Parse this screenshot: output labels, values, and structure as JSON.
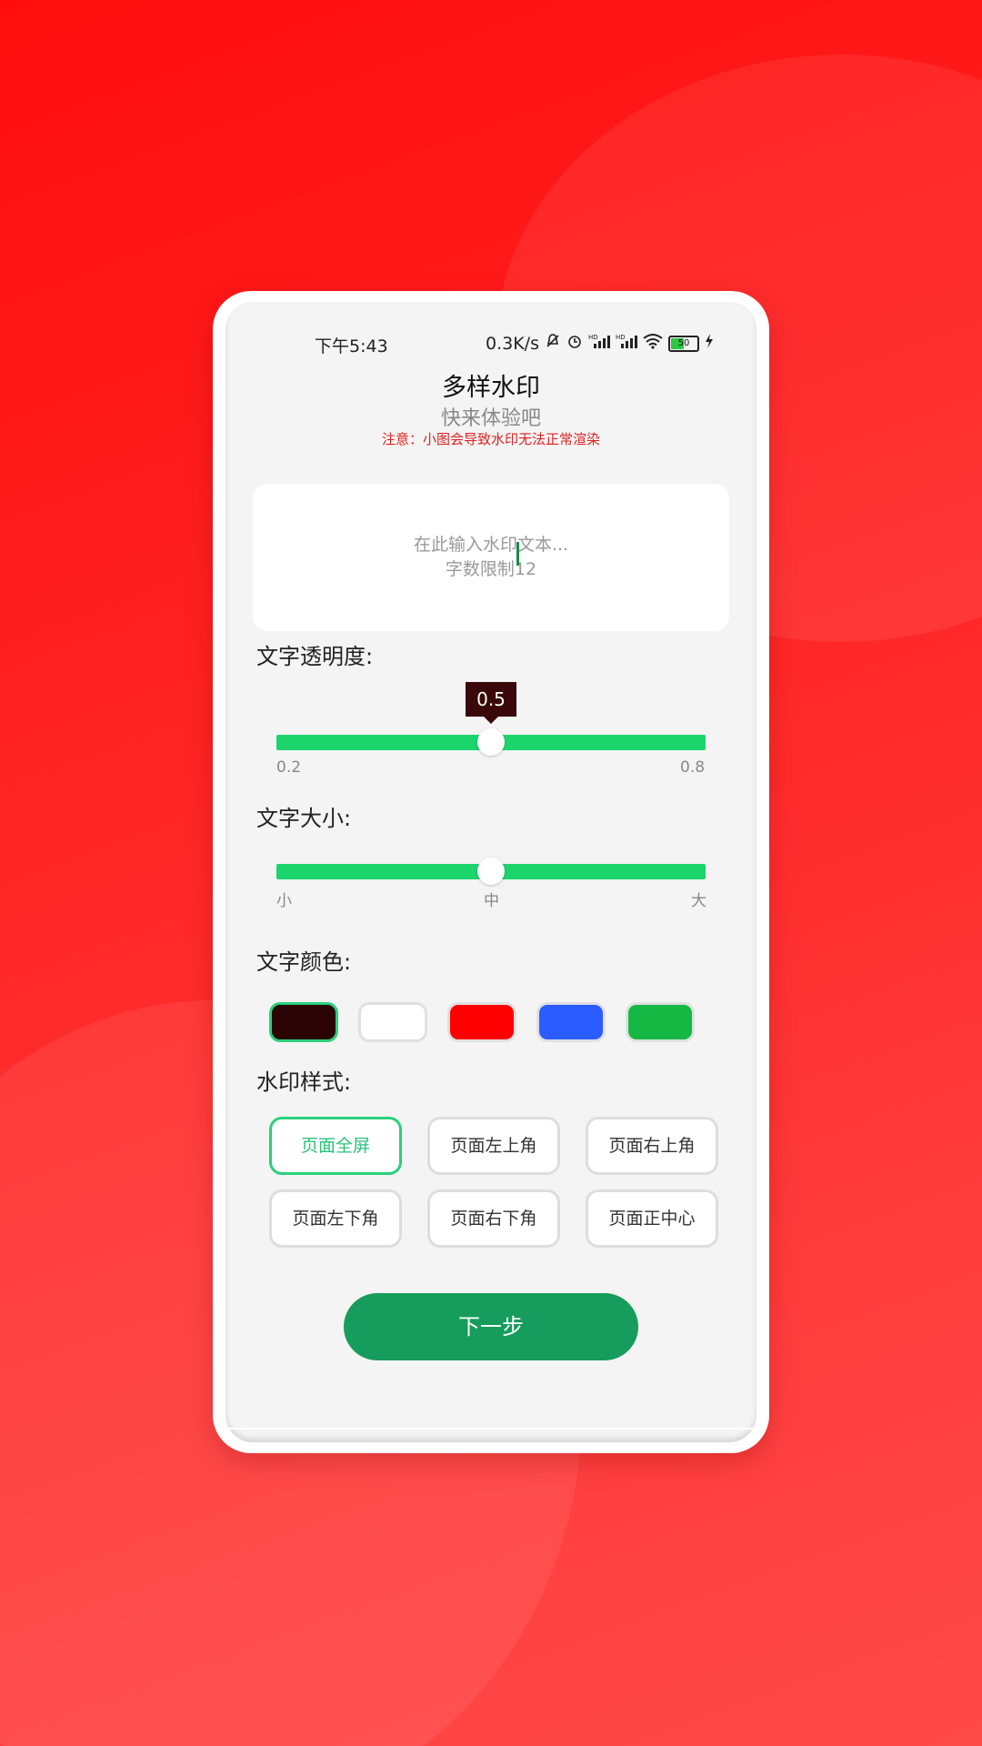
{
  "status_bar": {
    "time": "下午5:43",
    "net_speed": "0.3K/s",
    "signal_label_1": "HD",
    "signal_label_2": "HD",
    "battery": "50"
  },
  "header": {
    "title": "多样水印",
    "subtitle": "快来体验吧",
    "notice": "注意：小图会导致水印无法正常渲染"
  },
  "text_input": {
    "placeholder": "在此输入水印文本...\n字数限制12"
  },
  "opacity": {
    "label": "文字透明度:",
    "value": 0.5,
    "value_label": "0.5",
    "min_label": "0.2",
    "max_label": "0.8"
  },
  "size": {
    "label": "文字大小:",
    "value_fraction": 0.5,
    "ticks": [
      "小",
      "中",
      "大"
    ]
  },
  "color": {
    "label": "文字颜色:",
    "swatches": [
      "#2a0404",
      "#ffffff",
      "#ff0000",
      "#2a5cff",
      "#16b844"
    ],
    "selected_index": 0
  },
  "style": {
    "label": "水印样式:",
    "options": [
      "页面全屏",
      "页面左上角",
      "页面右上角",
      "页面左下角",
      "页面右下角",
      "页面正中心"
    ],
    "selected_index": 0
  },
  "next_button": "下一步",
  "colors": {
    "background": "#ff1a1a",
    "slider": "#1cd46c",
    "accent": "#2ad07c",
    "primary_button": "#169c5c"
  }
}
